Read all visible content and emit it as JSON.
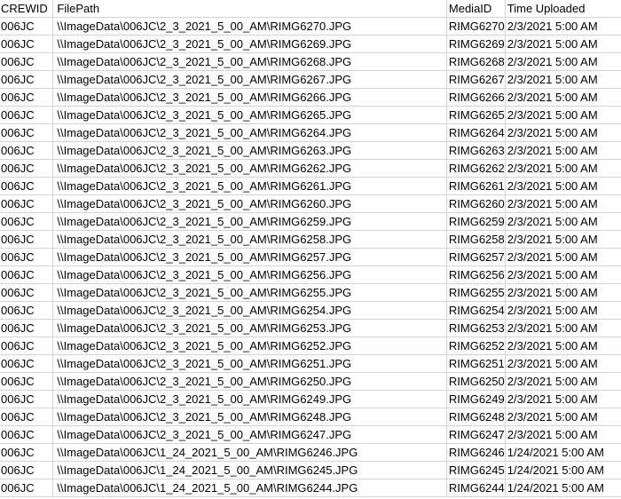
{
  "sheet": {
    "headers": [
      "CREWID",
      "FilePath",
      "MediaID",
      "Time Uploaded"
    ],
    "rows": [
      [
        "006JC",
        "\\\\ImageData\\006JC\\2_3_2021_5_00_AM\\RIMG6270.JPG",
        "RIMG6270",
        "2/3/2021 5:00 AM"
      ],
      [
        "006JC",
        "\\\\ImageData\\006JC\\2_3_2021_5_00_AM\\RIMG6269.JPG",
        "RIMG6269",
        "2/3/2021 5:00 AM"
      ],
      [
        "006JC",
        "\\\\ImageData\\006JC\\2_3_2021_5_00_AM\\RIMG6268.JPG",
        "RIMG6268",
        "2/3/2021 5:00 AM"
      ],
      [
        "006JC",
        "\\\\ImageData\\006JC\\2_3_2021_5_00_AM\\RIMG6267.JPG",
        "RIMG6267",
        "2/3/2021 5:00 AM"
      ],
      [
        "006JC",
        "\\\\ImageData\\006JC\\2_3_2021_5_00_AM\\RIMG6266.JPG",
        "RIMG6266",
        "2/3/2021 5:00 AM"
      ],
      [
        "006JC",
        "\\\\ImageData\\006JC\\2_3_2021_5_00_AM\\RIMG6265.JPG",
        "RIMG6265",
        "2/3/2021 5:00 AM"
      ],
      [
        "006JC",
        "\\\\ImageData\\006JC\\2_3_2021_5_00_AM\\RIMG6264.JPG",
        "RIMG6264",
        "2/3/2021 5:00 AM"
      ],
      [
        "006JC",
        "\\\\ImageData\\006JC\\2_3_2021_5_00_AM\\RIMG6263.JPG",
        "RIMG6263",
        "2/3/2021 5:00 AM"
      ],
      [
        "006JC",
        "\\\\ImageData\\006JC\\2_3_2021_5_00_AM\\RIMG6262.JPG",
        "RIMG6262",
        "2/3/2021 5:00 AM"
      ],
      [
        "006JC",
        "\\\\ImageData\\006JC\\2_3_2021_5_00_AM\\RIMG6261.JPG",
        "RIMG6261",
        "2/3/2021 5:00 AM"
      ],
      [
        "006JC",
        "\\\\ImageData\\006JC\\2_3_2021_5_00_AM\\RIMG6260.JPG",
        "RIMG6260",
        "2/3/2021 5:00 AM"
      ],
      [
        "006JC",
        "\\\\ImageData\\006JC\\2_3_2021_5_00_AM\\RIMG6259.JPG",
        "RIMG6259",
        "2/3/2021 5:00 AM"
      ],
      [
        "006JC",
        "\\\\ImageData\\006JC\\2_3_2021_5_00_AM\\RIMG6258.JPG",
        "RIMG6258",
        "2/3/2021 5:00 AM"
      ],
      [
        "006JC",
        "\\\\ImageData\\006JC\\2_3_2021_5_00_AM\\RIMG6257.JPG",
        "RIMG6257",
        "2/3/2021 5:00 AM"
      ],
      [
        "006JC",
        "\\\\ImageData\\006JC\\2_3_2021_5_00_AM\\RIMG6256.JPG",
        "RIMG6256",
        "2/3/2021 5:00 AM"
      ],
      [
        "006JC",
        "\\\\ImageData\\006JC\\2_3_2021_5_00_AM\\RIMG6255.JPG",
        "RIMG6255",
        "2/3/2021 5:00 AM"
      ],
      [
        "006JC",
        "\\\\ImageData\\006JC\\2_3_2021_5_00_AM\\RIMG6254.JPG",
        "RIMG6254",
        "2/3/2021 5:00 AM"
      ],
      [
        "006JC",
        "\\\\ImageData\\006JC\\2_3_2021_5_00_AM\\RIMG6253.JPG",
        "RIMG6253",
        "2/3/2021 5:00 AM"
      ],
      [
        "006JC",
        "\\\\ImageData\\006JC\\2_3_2021_5_00_AM\\RIMG6252.JPG",
        "RIMG6252",
        "2/3/2021 5:00 AM"
      ],
      [
        "006JC",
        "\\\\ImageData\\006JC\\2_3_2021_5_00_AM\\RIMG6251.JPG",
        "RIMG6251",
        "2/3/2021 5:00 AM"
      ],
      [
        "006JC",
        "\\\\ImageData\\006JC\\2_3_2021_5_00_AM\\RIMG6250.JPG",
        "RIMG6250",
        "2/3/2021 5:00 AM"
      ],
      [
        "006JC",
        "\\\\ImageData\\006JC\\2_3_2021_5_00_AM\\RIMG6249.JPG",
        "RIMG6249",
        "2/3/2021 5:00 AM"
      ],
      [
        "006JC",
        "\\\\ImageData\\006JC\\2_3_2021_5_00_AM\\RIMG6248.JPG",
        "RIMG6248",
        "2/3/2021 5:00 AM"
      ],
      [
        "006JC",
        "\\\\ImageData\\006JC\\2_3_2021_5_00_AM\\RIMG6247.JPG",
        "RIMG6247",
        "2/3/2021 5:00 AM"
      ],
      [
        "006JC",
        "\\\\ImageData\\006JC\\1_24_2021_5_00_AM\\RIMG6246.JPG",
        "RIMG6246",
        "1/24/2021 5:00 AM"
      ],
      [
        "006JC",
        "\\\\ImageData\\006JC\\1_24_2021_5_00_AM\\RIMG6245.JPG",
        "RIMG6245",
        "1/24/2021 5:00 AM"
      ],
      [
        "006JC",
        "\\\\ImageData\\006JC\\1_24_2021_5_00_AM\\RIMG6244.JPG",
        "RIMG6244",
        "1/24/2021 5:00 AM"
      ]
    ]
  }
}
